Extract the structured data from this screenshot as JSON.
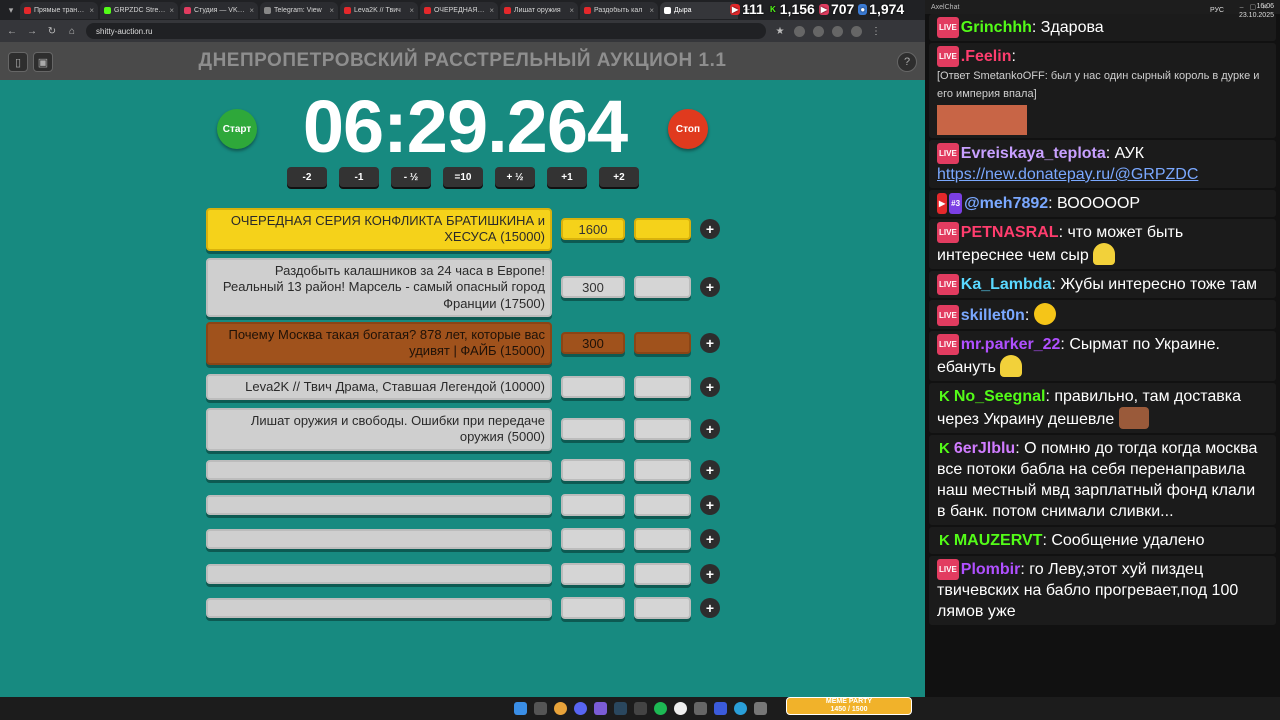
{
  "browser": {
    "tabs": [
      {
        "label": "Прямые трансля",
        "color": "#e4282b"
      },
      {
        "label": "GRPZDC Stream",
        "color": "#53fc18"
      },
      {
        "label": "Студия — VK Ви",
        "color": "#e23c60"
      },
      {
        "label": "Telegram: View",
        "color": "#888888"
      },
      {
        "label": "Leva2K // Твич",
        "color": "#e4282b"
      },
      {
        "label": "ОЧЕРЕДНАЯ СЕ",
        "color": "#e4282b"
      },
      {
        "label": "Лишат оружия",
        "color": "#e4282b"
      },
      {
        "label": "Раздобыть кал",
        "color": "#e4282b"
      },
      {
        "label": "Дыра",
        "color": "#ffffff"
      }
    ],
    "url": "shitty-auction.ru",
    "counters": [
      {
        "icon": "youtube",
        "value": "111",
        "color": "#e4282b"
      },
      {
        "icon": "kick",
        "value": "1,156",
        "color": "#53fc18"
      },
      {
        "icon": "vk-live",
        "value": "707",
        "color": "#e23c60"
      },
      {
        "icon": "viewers",
        "value": "1,974",
        "color": "#3a7bd5"
      }
    ]
  },
  "page": {
    "title": "ДНЕПРОПЕТРОВСКИЙ РАССТРЕЛЬНЫЙ АУКЦИОН 1.1",
    "timer": "06:29.264",
    "start_label": "Старт",
    "stop_label": "Стоп",
    "steps": [
      "-2",
      "-1",
      "- ½",
      "=10",
      "+ ½",
      "+1",
      "+2"
    ],
    "add_symbol": "+",
    "lots": [
      {
        "name": "ОЧЕРЕДНАЯ СЕРИЯ КОНФЛИКТА БРАТИШКИНА и ХЕСУСА (15000)",
        "amount": "1600",
        "style": "gold"
      },
      {
        "name": "Раздобыть калашников за 24 часа в Европе! Реальный 13 район! Марсель - самый опасный город Франции (17500)",
        "amount": "300",
        "style": "grey"
      },
      {
        "name": "Почему Москва такая богатая? 878 лет, которые вас удивят | ФАЙБ (15000)",
        "amount": "300",
        "style": "brown"
      },
      {
        "name": "Leva2K // Твич Драма, Ставшая Легендой (10000)",
        "amount": "",
        "style": "grey"
      },
      {
        "name": "Лишат оружия и свободы. Ошибки при передаче оружия (5000)",
        "amount": "",
        "style": "grey"
      },
      {
        "name": "",
        "amount": "",
        "style": "grey"
      },
      {
        "name": "",
        "amount": "",
        "style": "grey"
      },
      {
        "name": "",
        "amount": "",
        "style": "grey"
      },
      {
        "name": "",
        "amount": "",
        "style": "grey"
      },
      {
        "name": "",
        "amount": "",
        "style": "grey"
      }
    ],
    "colors": {
      "background": "#178a80",
      "start": "#2ea83a",
      "stop": "#e03a1e"
    }
  },
  "chat": {
    "window_title": "AxelChat",
    "messages": [
      {
        "platform": "vk",
        "nick": "Grinchhh",
        "nick_color": "#53fc18",
        "text": "Здарова"
      },
      {
        "platform": "vk",
        "nick": ".Feelin",
        "nick_color": "#ff3d6e",
        "text": "",
        "reply": "[Ответ SmetankoOFF: был у нас один сырный король в дурке и его империя впала]",
        "faces": true
      },
      {
        "platform": "vk",
        "nick": "Evreiskaya_teplota",
        "nick_color": "#c8a0ff",
        "text": "АУК",
        "link": "https://new.donatepay.ru/@GRPZDC"
      },
      {
        "platform": "yt",
        "nick": "@meh7892",
        "nick_color": "#7aa8ff",
        "text": "ВООООOР",
        "sub": "#3"
      },
      {
        "platform": "vk",
        "nick": "PETNASRAL",
        "nick_color": "#ff3d6e",
        "text": "что может быть интереснее чем сыр"
      },
      {
        "platform": "vk",
        "nick": "Ka_Lambda",
        "nick_color": "#5ad8ff",
        "text": "Жубы интересно тоже там"
      },
      {
        "platform": "vk",
        "nick": "skillet0n",
        "nick_color": "#7aa8ff",
        "text": ""
      },
      {
        "platform": "vk",
        "nick": "mr.parker_22",
        "nick_color": "#b050ff",
        "text": "Сырмат по Украине. ебануть"
      },
      {
        "platform": "kick",
        "nick": "No_Seegnal",
        "nick_color": "#53fc18",
        "text": "правильно, там доставка через Украину дешевле"
      },
      {
        "platform": "kick",
        "nick": "6erJlblu",
        "nick_color": "#d07cff",
        "text": "О помню до тогда когда москва все потоки бабла на себя перенаправила наш местный мвд зарплатный фонд клали в банк. потом снимали сливки..."
      },
      {
        "platform": "kick",
        "nick": "MAUZERVT",
        "nick_color": "#53fc18",
        "text": "Сообщение удалено"
      },
      {
        "platform": "vk",
        "nick": "Plombir",
        "nick_color": "#b050ff",
        "text": "го Леву,этот хуй пиздец твичевских на бабло прогревает,под 100 лямов уже"
      }
    ]
  },
  "taskbar": {
    "lang": "РУС",
    "time": "16:06",
    "date": "23.10.2025",
    "meme_title": "MEME PARTY",
    "meme_progress": "1450 / 1500"
  }
}
